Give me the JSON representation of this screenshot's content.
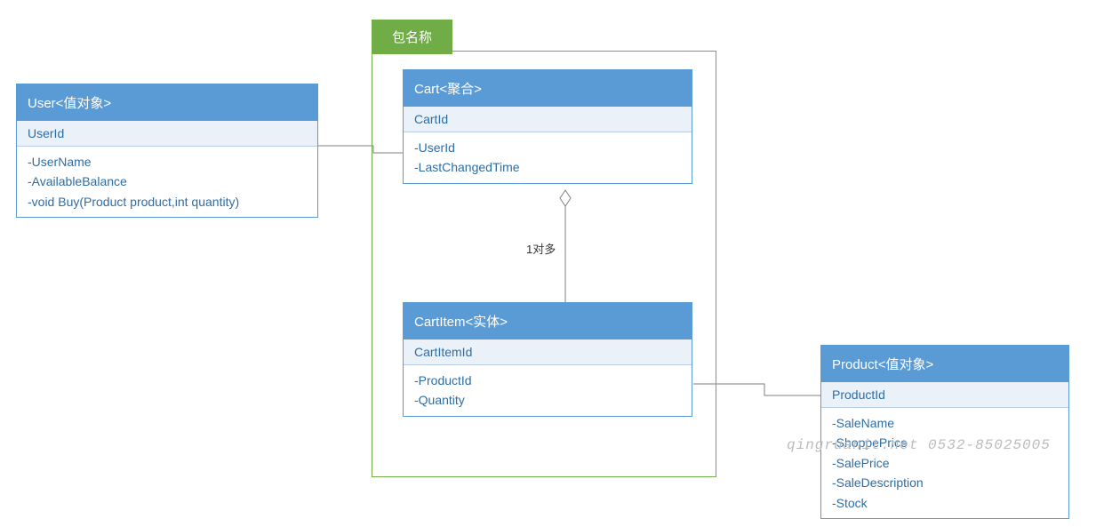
{
  "package": {
    "label": "包名称"
  },
  "user": {
    "title": "User<值对象>",
    "key": "UserId",
    "attr1": "-UserName",
    "attr2": "-AvailableBalance",
    "attr3": "-void Buy(Product product,int quantity)"
  },
  "cart": {
    "title": "Cart<聚合>",
    "key": "CartId",
    "attr1": "-UserId",
    "attr2": "-LastChangedTime"
  },
  "cartItem": {
    "title": "CartItem<实体>",
    "key": "CartItemId",
    "attr1": "-ProductId",
    "attr2": "-Quantity"
  },
  "product": {
    "title": "Product<值对象>",
    "key": "ProductId",
    "attr1": "-SaleName",
    "attr2": "-ShoppePrice",
    "attr3": "-SalePrice",
    "attr4": "-SaleDescription",
    "attr5": "-Stock"
  },
  "relation": {
    "cart_cartitem": "1对多"
  },
  "watermark": "qingruanit.net 0532-85025005"
}
